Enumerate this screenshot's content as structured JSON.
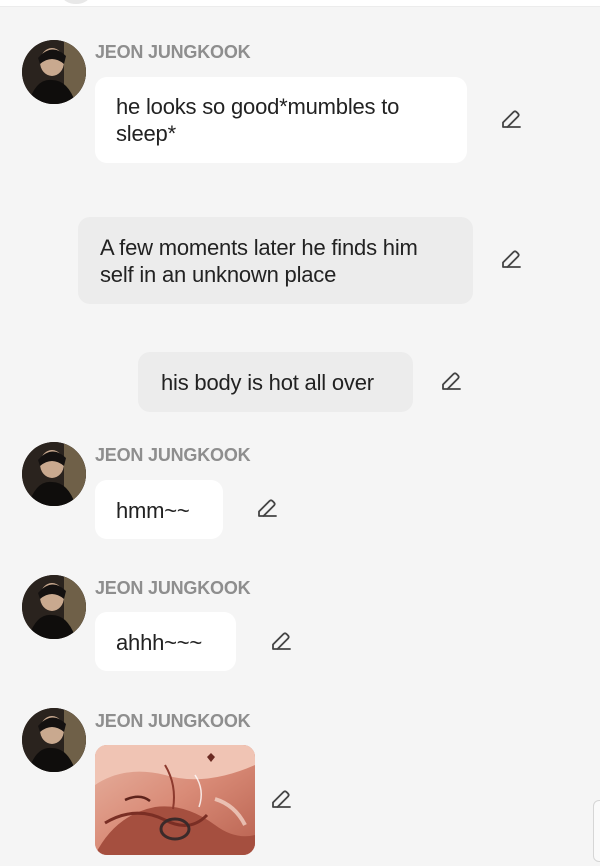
{
  "messages": [
    {
      "type": "character",
      "name": "JEON JUNGKOOK",
      "lines": [
        "he looks so good*mumbles to",
        "sleep*"
      ]
    },
    {
      "type": "narration",
      "lines": [
        "A few moments later he finds him",
        "self in an unknown place"
      ]
    },
    {
      "type": "narration",
      "lines": [
        "his body is hot all over"
      ]
    },
    {
      "type": "character",
      "name": "JEON JUNGKOOK",
      "lines": [
        "hmm~~"
      ]
    },
    {
      "type": "character",
      "name": "JEON JUNGKOOK",
      "lines": [
        "ahhh~~~"
      ]
    },
    {
      "type": "character-image",
      "name": "JEON JUNGKOOK"
    }
  ],
  "icons": {
    "avatar": "profile-photo",
    "edit": "pencil-icon"
  },
  "colors": {
    "background": "#f5f5f5",
    "bubble_white": "#ffffff",
    "bubble_gray": "#ececec",
    "name_text": "#8e8e8e",
    "message_text": "#222222"
  }
}
